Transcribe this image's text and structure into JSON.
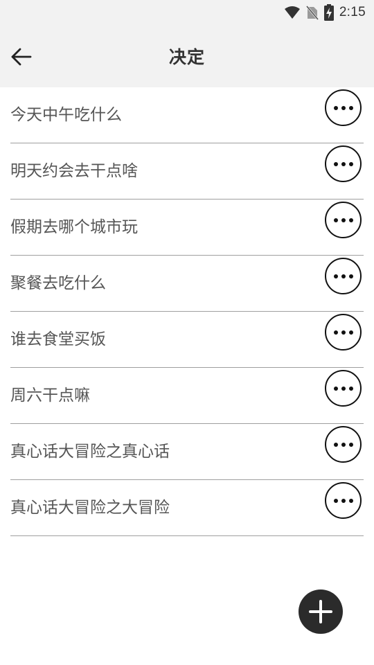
{
  "status_bar": {
    "time": "2:15",
    "icons": [
      "wifi-icon",
      "no-sim-icon",
      "battery-charging-icon"
    ]
  },
  "toolbar": {
    "back_icon": "arrow-left-icon",
    "title": "决定"
  },
  "decisions": [
    {
      "label": "今天中午吃什么"
    },
    {
      "label": "明天约会去干点啥"
    },
    {
      "label": "假期去哪个城市玩"
    },
    {
      "label": "聚餐去吃什么"
    },
    {
      "label": "谁去食堂买饭"
    },
    {
      "label": "周六干点嘛"
    },
    {
      "label": "真心话大冒险之真心话"
    },
    {
      "label": "真心话大冒险之大冒险"
    }
  ],
  "item_action_icon": "more-horizontal-icon",
  "fab": {
    "icon": "plus-icon"
  },
  "colors": {
    "app_bar_background": "#f2f2f2",
    "title_text": "#333333",
    "item_text": "#555555",
    "divider": "#9e9e9e",
    "fab_background": "#2b2b2b"
  }
}
